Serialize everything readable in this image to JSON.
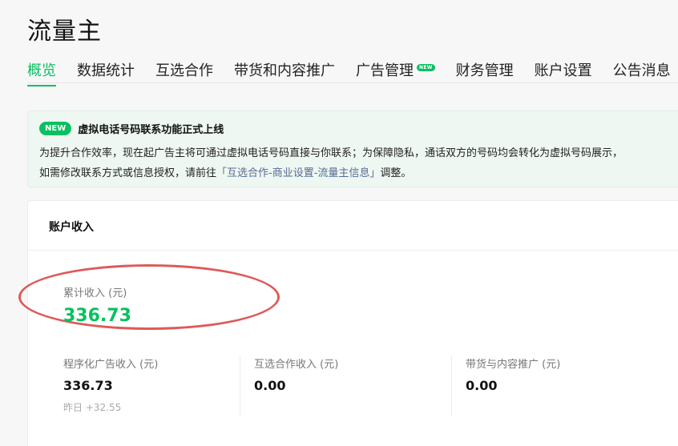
{
  "page_title": "流量主",
  "tabs": [
    {
      "label": "概览",
      "active": true
    },
    {
      "label": "数据统计"
    },
    {
      "label": "互选合作"
    },
    {
      "label": "带货和内容推广"
    },
    {
      "label": "广告管理",
      "badge": "NEW"
    },
    {
      "label": "财务管理"
    },
    {
      "label": "账户设置"
    },
    {
      "label": "公告消息"
    }
  ],
  "notice": {
    "badge": "NEW",
    "title": "虚拟电话号码联系功能正式上线",
    "line1": "为提升合作效率，现在起广告主将可通过虚拟电话号码直接与你联系；为保障隐私，通话双方的号码均会转化为虚拟号码展示，",
    "line2_prefix": "如需修改联系方式或信息授权，请前往",
    "line2_link": "「互选合作-商业设置-流量主信息」",
    "line2_suffix": "调整。"
  },
  "income": {
    "header": "账户收入",
    "total_label": "累计收入 (元)",
    "total_value": "336.73",
    "stats": [
      {
        "label": "程序化广告收入 (元)",
        "value": "336.73",
        "sub": "昨日 +32.55"
      },
      {
        "label": "互选合作收入 (元)",
        "value": "0.00"
      },
      {
        "label": "带货与内容推广 (元)",
        "value": "0.00"
      }
    ]
  },
  "colors": {
    "accent": "#07c160",
    "annotation": "#de5a5a",
    "link": "#576b95"
  }
}
